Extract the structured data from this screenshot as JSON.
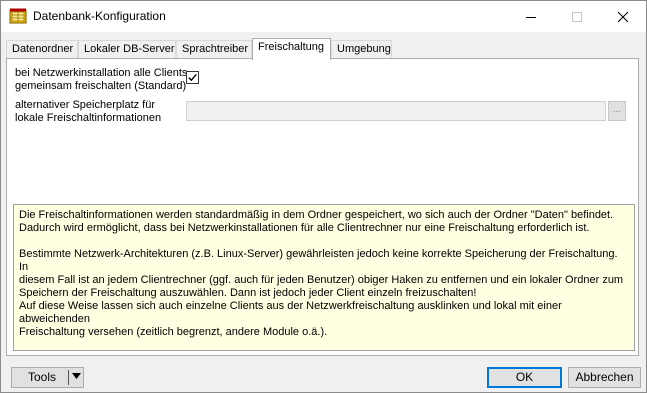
{
  "window": {
    "title": "Datenbank-Konfiguration",
    "app_icon": "app-database-icon"
  },
  "tabs": [
    {
      "label": "Datenordner",
      "active": false
    },
    {
      "label": "Lokaler DB-Server",
      "active": false
    },
    {
      "label": "Sprachtreiber",
      "active": false
    },
    {
      "label": "Freischaltung",
      "active": true
    },
    {
      "label": "Umgebung",
      "active": false
    }
  ],
  "freischaltung": {
    "network_label_line1": "bei Netzwerkinstallation alle Clients",
    "network_label_line2": "gemeinsam freischalten (Standard)",
    "network_checked": true,
    "path_label_line1": "alternativer Speicherplatz für",
    "path_label_line2": "lokale Freischaltinformationen",
    "path_value": "",
    "browse_label": "...",
    "info_text": "Die Freischaltinformationen werden standardmäßig in dem Ordner gespeichert, wo sich auch der Ordner \"Daten\" befindet.\nDadurch wird ermöglicht, dass bei Netzwerkinstallationen für alle Clientrechner nur eine Freischaltung erforderlich ist.\n\nBestimmte Netzwerk-Architekturen (z.B. Linux-Server) gewährleisten jedoch keine korrekte Speicherung der Freischaltung. In\ndiesem Fall ist an jedem Clientrechner (ggf. auch für jeden Benutzer) obiger Haken zu entfernen und ein lokaler Ordner zum\nSpeichern der Freischaltung auszuwählen. Dann ist jedoch jeder Client einzeln freizuschalten!\nAuf diese Weise lassen sich auch einzelne Clients aus der Netzwerkfreischaltung ausklinken und lokal mit einer abweichenden\nFreischaltung versehen (zeitlich begrenzt, andere Module o.ä.)."
  },
  "footer": {
    "tools_label": "Tools",
    "ok_label": "OK",
    "cancel_label": "Abbrechen"
  },
  "colors": {
    "info_background": "#ffffe1",
    "ok_focus_border": "#0078d7"
  }
}
